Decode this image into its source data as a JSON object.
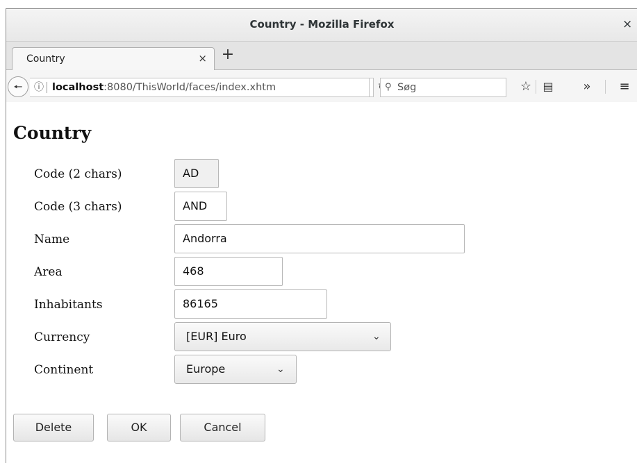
{
  "window": {
    "title": "Country - Mozilla Firefox",
    "close_glyph": "×"
  },
  "tabs": [
    {
      "label": "Country",
      "close_glyph": "×"
    }
  ],
  "new_tab_glyph": "+",
  "navbar": {
    "url_host": "localhost",
    "url_rest": ":8080/ThisWorld/faces/index.xhtm",
    "search_placeholder": "Søg",
    "icons": [
      "back-arrow-icon",
      "info-icon",
      "reload-icon",
      "search-icon",
      "bookmark-star-icon",
      "reading-list-icon",
      "overflow-chevrons-icon",
      "hamburger-menu-icon"
    ]
  },
  "page": {
    "heading": "Country",
    "fields": [
      {
        "label": "Code (2 chars)",
        "value": "AD"
      },
      {
        "label": "Code (3 chars)",
        "value": "AND"
      },
      {
        "label": "Name",
        "value": "Andorra"
      },
      {
        "label": "Area",
        "value": "468"
      },
      {
        "label": "Inhabitants",
        "value": "86165"
      }
    ],
    "currency": {
      "label": "Currency",
      "selected": "[EUR] Euro"
    },
    "continent": {
      "label": "Continent",
      "selected": "Europe"
    },
    "buttons": {
      "delete": "Delete",
      "ok": "OK",
      "cancel": "Cancel"
    }
  },
  "colors": {
    "accent_text": "#111111",
    "chrome_bg": "#f5f5f5",
    "field_border": "#b7b7b7"
  }
}
